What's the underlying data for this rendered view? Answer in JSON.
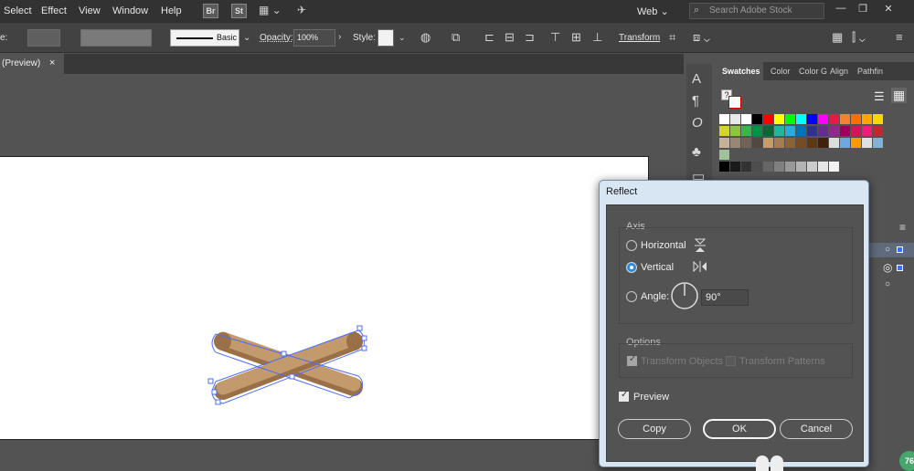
{
  "menubar": {
    "items": [
      "Select",
      "Effect",
      "View",
      "Window",
      "Help"
    ],
    "bridge_icon": "Br",
    "stock_icon": "St",
    "workspace": "Web",
    "search_placeholder": "Search Adobe Stock"
  },
  "controlbar": {
    "stroke_label": "e:",
    "brush": "Basic",
    "opacity_label": "Opacity:",
    "opacity_value": "100%",
    "style_label": "Style:",
    "transform_label": "Transform"
  },
  "doc_tab": {
    "title": "(Preview)",
    "close": "×"
  },
  "panels": {
    "tabs": [
      "Swatches",
      "Color",
      "Color G",
      "Align",
      "Pathfin"
    ],
    "tool_glyph_char": "A",
    "tool_glyph_para": "¶",
    "tool_glyph_glyphs": "O"
  },
  "dialog": {
    "title": "Reflect",
    "axis_title": "Axis",
    "horizontal_label": "Horizontal",
    "vertical_label": "Vertical",
    "angle_label": "Angle:",
    "angle_value": "90°",
    "selected_axis": "vertical",
    "options_title": "Options",
    "transform_objects_label": "Transform Objects",
    "transform_patterns_label": "Transform Patterns",
    "preview_label": "Preview",
    "preview_checked": true,
    "copy_label": "Copy",
    "ok_label": "OK",
    "cancel_label": "Cancel"
  },
  "status_badge": "76",
  "colors": {
    "menubar": "#323232",
    "workspace_bg": "#535353",
    "artwork_fill": "#c39a6b",
    "artwork_shadow": "#9a7048",
    "selection": "#4a6cff",
    "dialog_frame": "#d8e5f2"
  }
}
